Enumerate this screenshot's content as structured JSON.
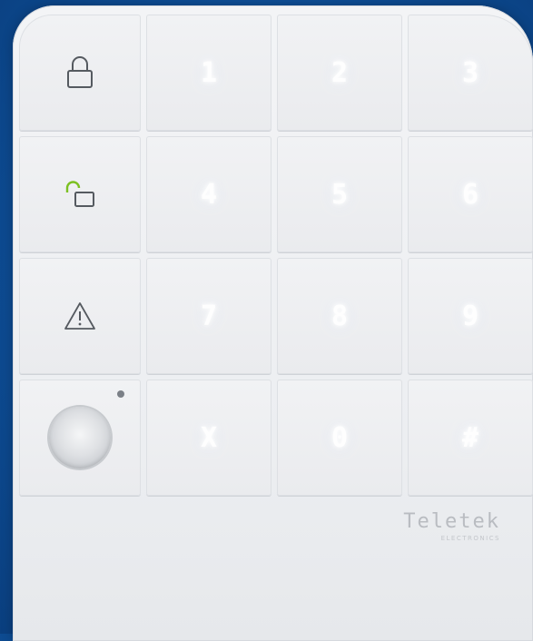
{
  "keys": {
    "k1": "1",
    "k2": "2",
    "k3": "3",
    "k4": "4",
    "k5": "5",
    "k6": "6",
    "k7": "7",
    "k8": "8",
    "k9": "9",
    "kx": "X",
    "k0": "0",
    "khash": "#"
  },
  "function_keys": {
    "arm_icon": "lock-closed-icon",
    "disarm_icon": "lock-open-icon",
    "panic_icon": "warning-triangle-icon",
    "sensor_icon": "proximity-sensor-icon"
  },
  "brand": {
    "name": "Teletek",
    "subtitle": "ELECTRONICS"
  },
  "colors": {
    "background": "#0d4b91",
    "device": "#eef0f2",
    "disarm_accent": "#7cc022"
  }
}
